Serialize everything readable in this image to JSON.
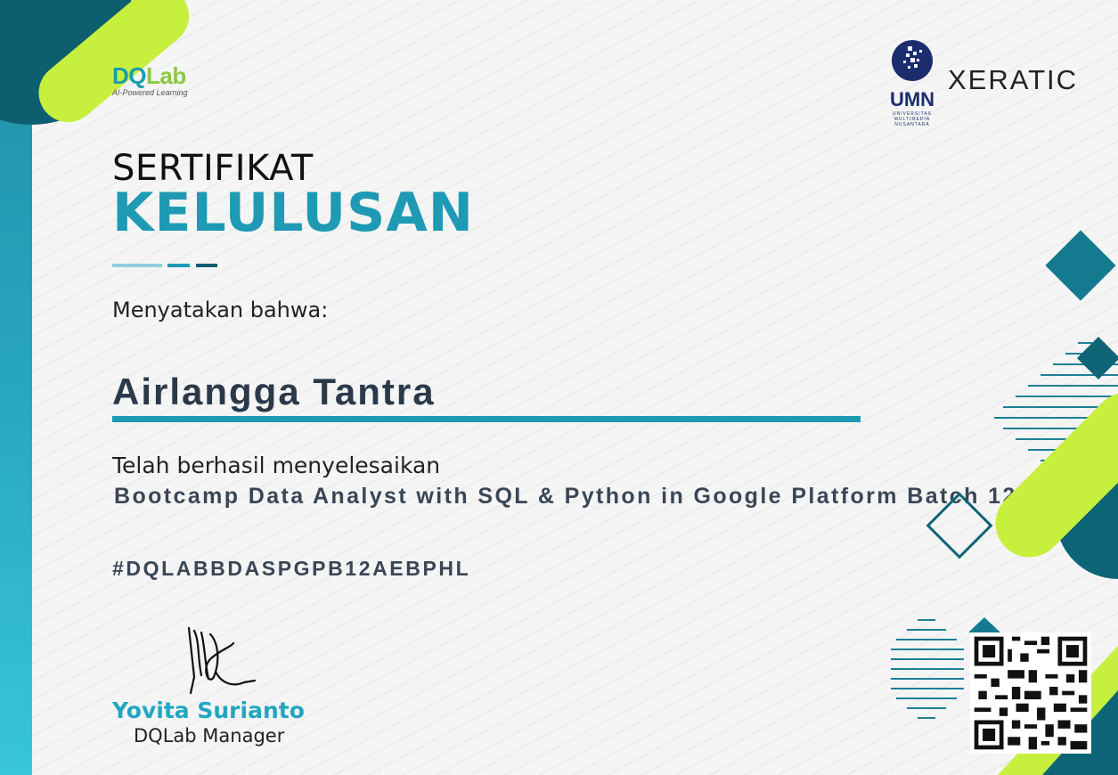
{
  "brand": {
    "logo_text_d": "D",
    "logo_text_q": "Q",
    "logo_text_lab": "Lab",
    "tagline": "AI-Powered Learning"
  },
  "partners": {
    "umn_abbr": "UMN",
    "umn_sub_1": "UNIVERSITAS",
    "umn_sub_2": "MULTIMEDIA",
    "umn_sub_3": "NUSANTARA",
    "xeratic": "XERATIC"
  },
  "certificate": {
    "title_line1": "SERTIFIKAT",
    "title_line2": "KELULUSAN",
    "statement": "Menyatakan bahwa:",
    "recipient_name": "Airlangga Tantra",
    "completed_label": "Telah berhasil menyelesaikan",
    "course_name": "Bootcamp Data Analyst with SQL & Python in Google Platform Batch 12",
    "certificate_code": "#DQLABBDASPGPB12AEBPHL"
  },
  "signatory": {
    "name": "Yovita Surianto",
    "role": "DQLab Manager"
  },
  "colors": {
    "teal": "#1e9ab4",
    "dark_teal": "#0d5e6f",
    "lime": "#c6f03d",
    "text_dark": "#2b3a4a"
  },
  "icons": {
    "signature": "handwritten-signature",
    "qr": "qr-code",
    "umn_mark": "umn-dot-globe-icon"
  }
}
